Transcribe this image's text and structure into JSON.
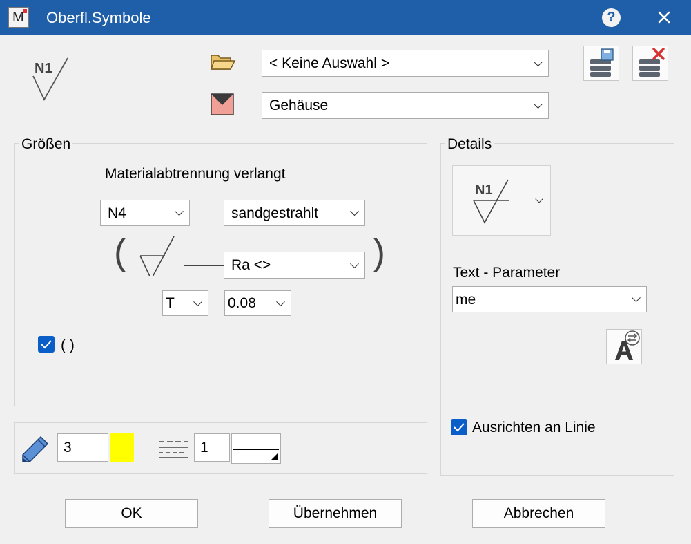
{
  "window": {
    "title": "Oberfl.Symbole",
    "app_icon_letter": "M",
    "help_glyph": "?"
  },
  "header": {
    "preview_label": "N1",
    "template_combo": "< Keine Auswahl >",
    "category_combo": "Gehäuse"
  },
  "groessen": {
    "group_label": "Größen",
    "heading": "Materialabtrennung verlangt",
    "class_combo": "N4",
    "process_combo": "sandgestrahlt",
    "paren_left": "(",
    "paren_right": ")",
    "param_combo": "Ra <>",
    "direction_combo": "T",
    "value_combo": "0.08",
    "checkbox_label": "( )",
    "checkbox_checked": true
  },
  "pen": {
    "pen_value": "3",
    "color": "#ffff00",
    "linetype_value": "1"
  },
  "details": {
    "group_label": "Details",
    "symbol_label": "N1",
    "text_param_label": "Text - Parameter",
    "text_param_combo": "me",
    "align_label": "Ausrichten an Linie",
    "align_checked": true
  },
  "buttons": {
    "ok": "OK",
    "apply": "Übernehmen",
    "cancel": "Abbrechen"
  }
}
